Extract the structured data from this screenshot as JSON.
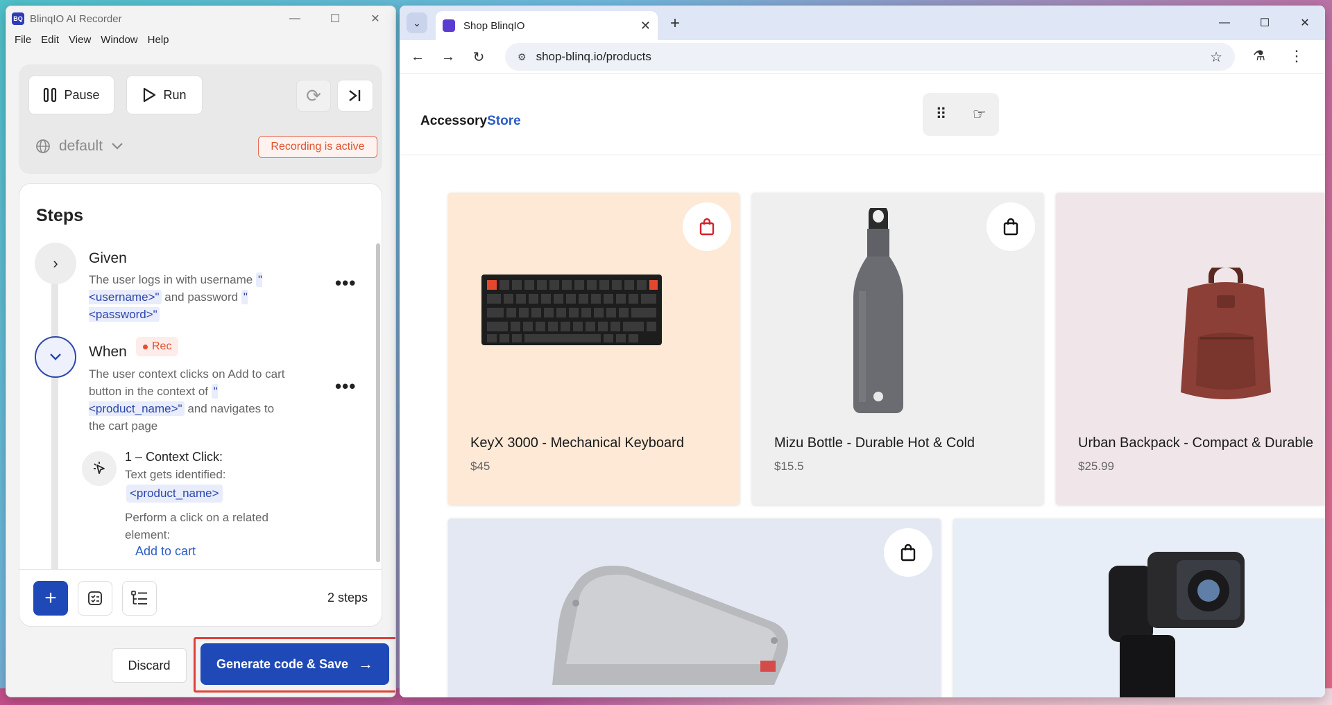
{
  "recorder": {
    "title": "BlinqIO AI Recorder",
    "menu": [
      "File",
      "Edit",
      "View",
      "Window",
      "Help"
    ],
    "pause_label": "Pause",
    "run_label": "Run",
    "env_label": "default",
    "recording_status": "Recording is active",
    "steps_heading": "Steps",
    "given": {
      "keyword": "Given",
      "text_1": "The user logs in with username",
      "param_1": "\"<username>\"",
      "text_2": "and password",
      "param_2": "\"<password>\""
    },
    "when": {
      "keyword": "When",
      "rec_label": "Rec",
      "text_1": "The user context clicks on Add to cart button in the context of",
      "param_1": "\"<product_name>\"",
      "text_2": "and navigates to the cart page"
    },
    "sub_step": {
      "title": "1 – Context Click:",
      "line_1": "Text gets identified:",
      "param": "<product_name>",
      "line_2": "Perform a click on a related",
      "line_3": "element:",
      "link": "Add to cart"
    },
    "steps_count": "2 steps",
    "discard_label": "Discard",
    "generate_label": "Generate code & Save"
  },
  "browser": {
    "tab_title": "Shop BlinqIO",
    "url": "shop-blinq.io/products",
    "colors": {
      "tab_bar": "#dfe6f5",
      "accent": "#1f49b7"
    }
  },
  "store": {
    "logo_part1": "Accessory",
    "logo_part2": "Store",
    "products": [
      {
        "name": "KeyX 3000 - Mechanical Keyboard",
        "price": "$45",
        "bg": "#fde9d6"
      },
      {
        "name": "Mizu Bottle - Durable Hot & Cold",
        "price": "$15.5",
        "bg": "#efefef"
      },
      {
        "name": "Urban Backpack - Compact & Durable",
        "price": "$25.99",
        "bg": "#f0e6ea"
      },
      {
        "name": "",
        "price": "",
        "bg": "#e3e8f3"
      },
      {
        "name": "",
        "price": "",
        "bg": "#e8eef8"
      }
    ]
  }
}
